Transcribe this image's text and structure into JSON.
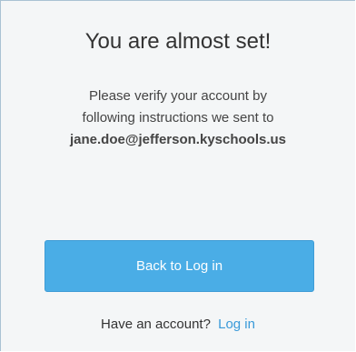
{
  "card": {
    "title": "You are almost set!",
    "message_line1": "Please verify your account by",
    "message_line2": "following instructions we sent to",
    "email": "jane.doe@jefferson.kyschools.us"
  },
  "actions": {
    "back_button_label": "Back to Log in"
  },
  "footer": {
    "prompt": "Have an account?",
    "login_link": "Log in"
  },
  "colors": {
    "primary_button": "#4aade6",
    "link": "#3a9ad9",
    "card_background": "#f4f6f7",
    "card_border": "#a9c2d3"
  }
}
